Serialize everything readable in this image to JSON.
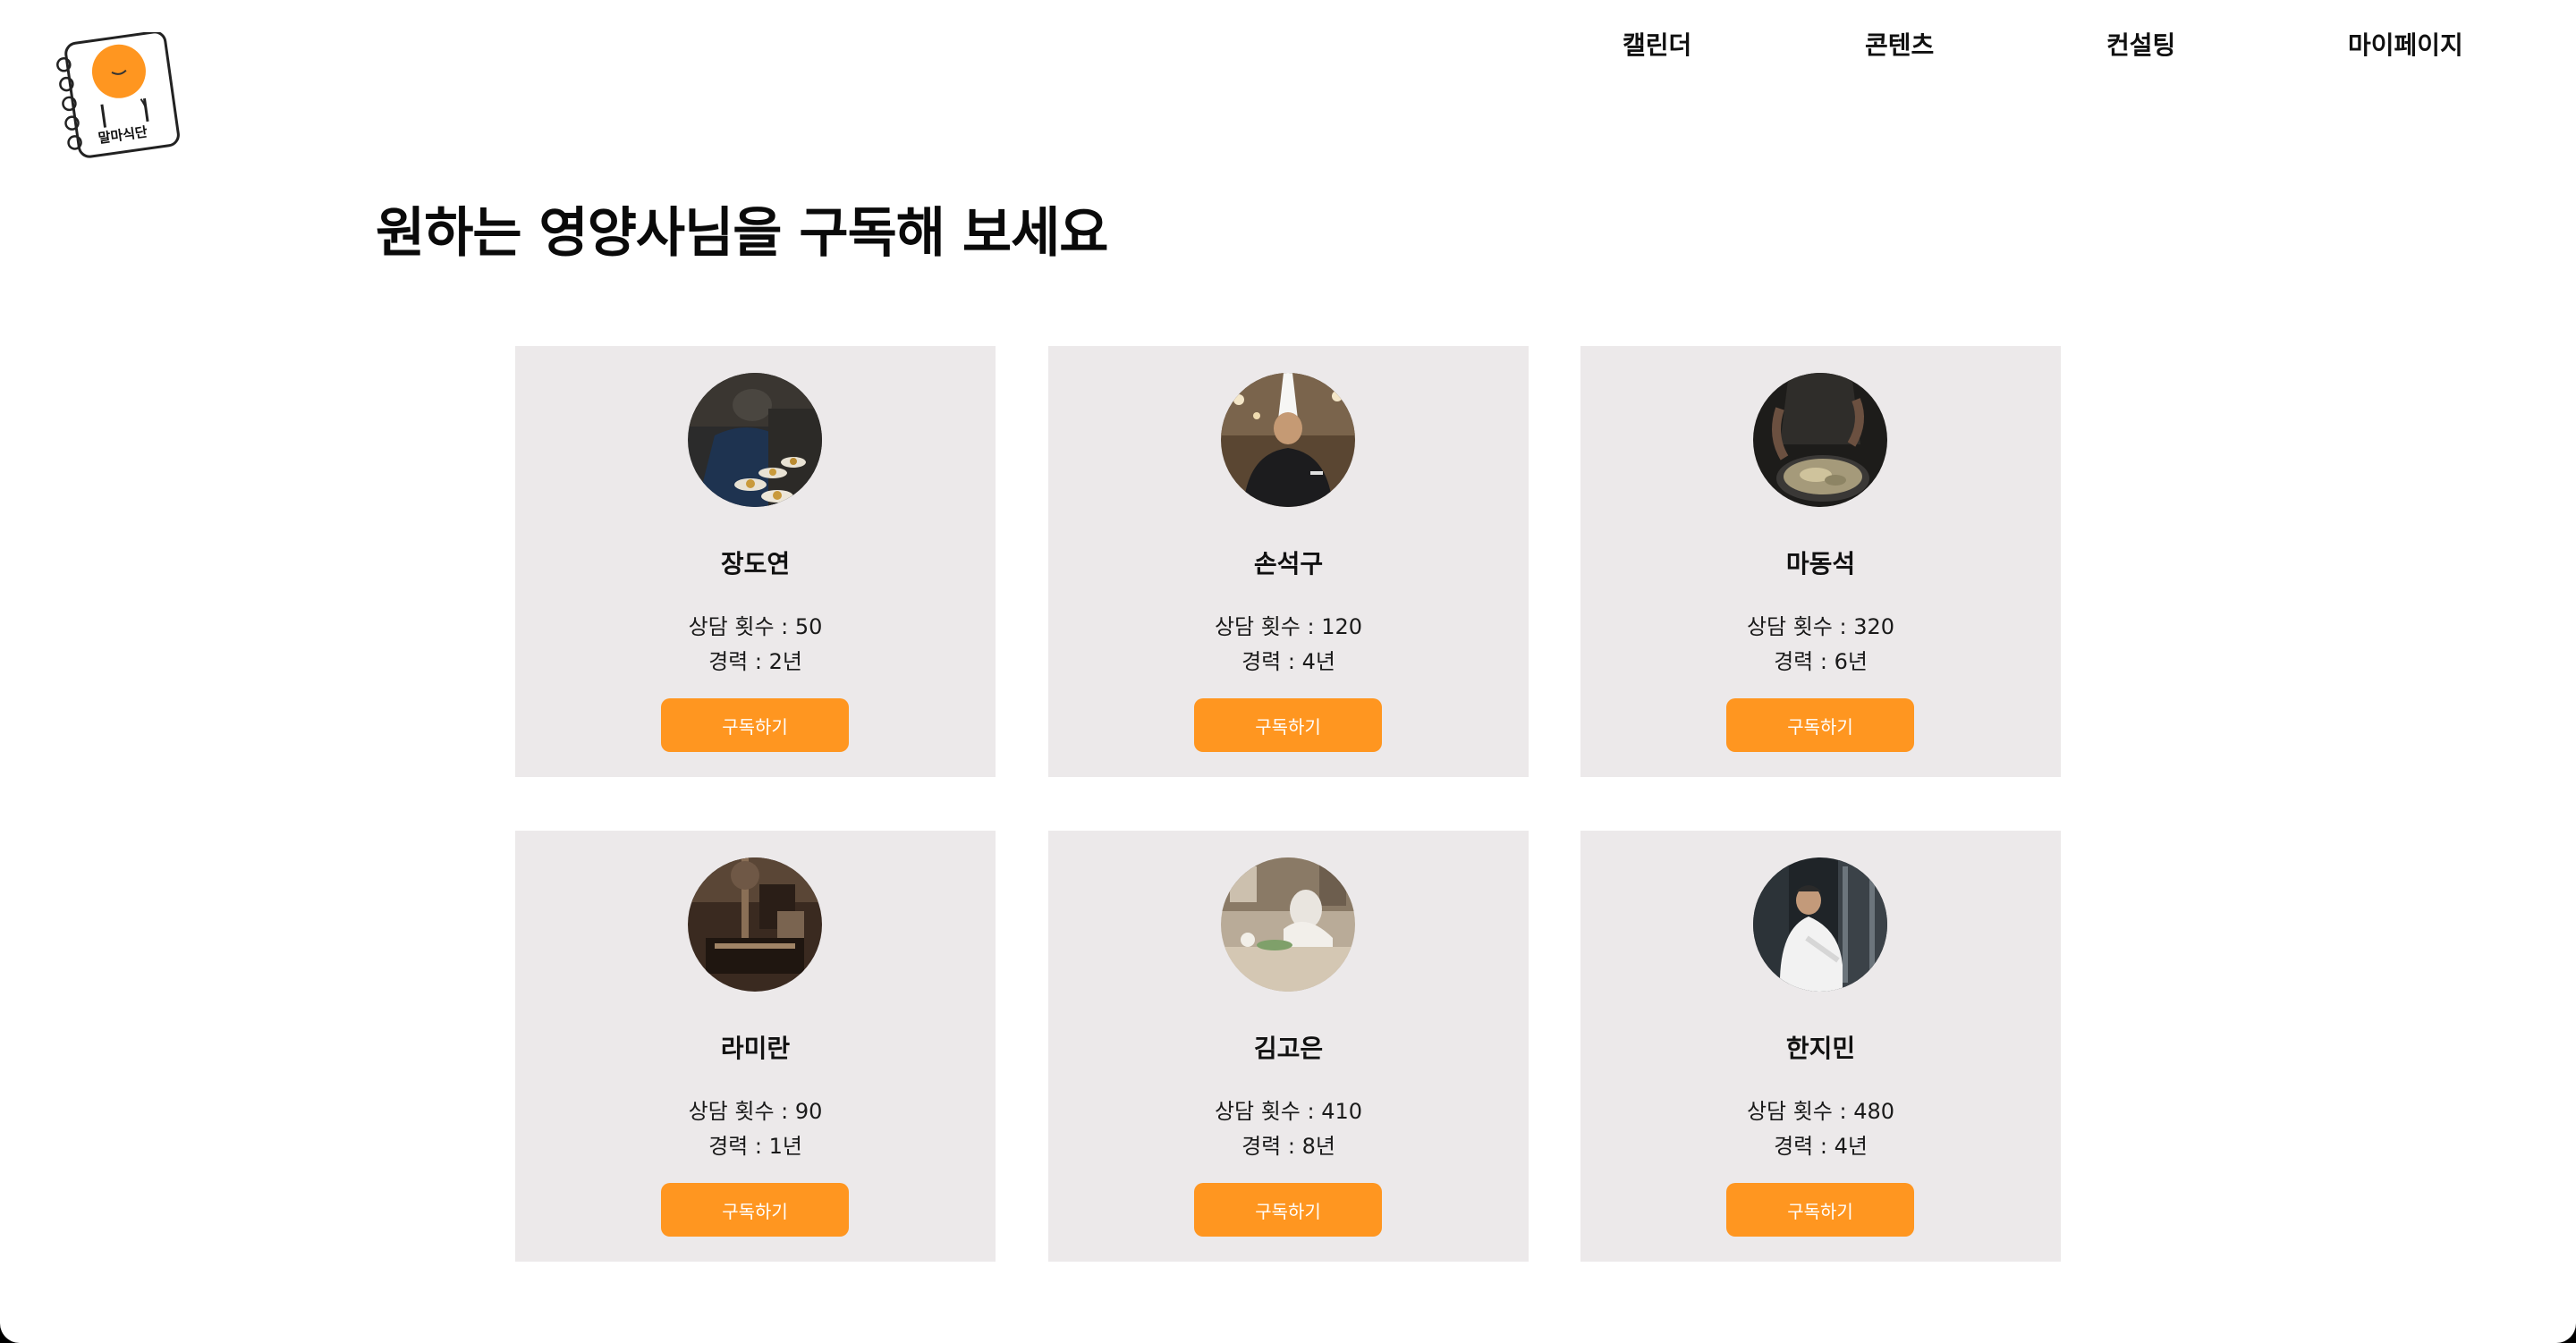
{
  "header": {
    "logo_text": "말마식단",
    "nav": [
      {
        "label": "캘린더"
      },
      {
        "label": "콘텐츠"
      },
      {
        "label": "컨설팅"
      },
      {
        "label": "마이페이지"
      }
    ]
  },
  "main": {
    "title": "원하는 영양사님을 구독해 보세요",
    "cards": [
      {
        "name": "장도연",
        "count_text": "상담 횟수 : 50",
        "career_text": "경력 : 2년",
        "button_label": "구독하기",
        "photo": "chef-plating-photo"
      },
      {
        "name": "손석구",
        "count_text": "상담 횟수 : 120",
        "career_text": "경력 : 4년",
        "button_label": "구독하기",
        "photo": "chef-with-tall-hat-photo"
      },
      {
        "name": "마동석",
        "count_text": "상담 횟수 : 320",
        "career_text": "경력 : 6년",
        "button_label": "구독하기",
        "photo": "chef-cooking-pan-photo"
      },
      {
        "name": "라미란",
        "count_text": "상담 횟수 : 90",
        "career_text": "경력 : 1년",
        "button_label": "구독하기",
        "photo": "kitchen-equipment-photo"
      },
      {
        "name": "김고은",
        "count_text": "상담 횟수 : 410",
        "career_text": "경력 : 8년",
        "button_label": "구독하기",
        "photo": "kitchen-counter-photo"
      },
      {
        "name": "한지민",
        "count_text": "상담 횟수 : 480",
        "career_text": "경력 : 4년",
        "button_label": "구독하기",
        "photo": "chef-white-coat-photo"
      }
    ]
  },
  "colors": {
    "accent": "#ff9620",
    "card_background": "#ece9ea",
    "text": "#111111"
  }
}
